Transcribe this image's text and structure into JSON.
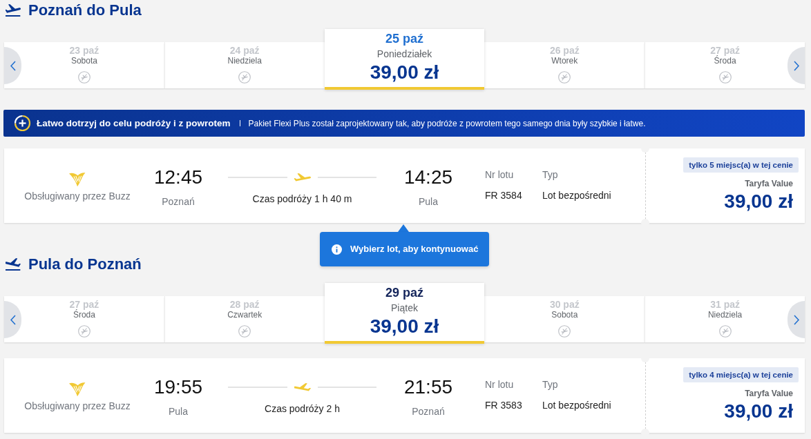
{
  "journeys": [
    {
      "kind": "outbound",
      "title": "Poznań do Pula",
      "days": [
        {
          "date": "23 paź",
          "weekday": "Sobota",
          "available": false,
          "selected": false,
          "hovered": false
        },
        {
          "date": "24 paź",
          "weekday": "Niedziela",
          "available": false,
          "selected": false,
          "hovered": false
        },
        {
          "date": "25 paź",
          "weekday": "Poniedziałek",
          "price": "39,00 zł",
          "available": true,
          "selected": true,
          "hovered": true
        },
        {
          "date": "26 paź",
          "weekday": "Wtorek",
          "available": false,
          "selected": false,
          "hovered": false
        },
        {
          "date": "27 paź",
          "weekday": "Środa",
          "available": false,
          "selected": false,
          "hovered": false
        }
      ],
      "promo_banner": {
        "title": "Łatwo dotrzyj do celu podróży i z powrotem",
        "text": "Pakiet Flexi Plus został zaprojektowany tak, aby podróże z powrotem tego samego dnia były szybkie i łatwe."
      },
      "flight": {
        "operator": "Obsługiwany przez Buzz",
        "departure_time": "12:45",
        "departure_city": "Poznań",
        "duration": "Czas podróży 1 h 40 m",
        "arrival_time": "14:25",
        "arrival_city": "Pula",
        "flight_number_label": "Nr lotu",
        "flight_number": "FR 3584",
        "type_label": "Typ",
        "type": "Lot bezpośredni",
        "seats_badge": "tylko 5 miejsc(a) w tej cenie",
        "fare": "Taryfa Value",
        "price": "39,00 zł"
      },
      "notice": {
        "text": "Wybierz lot, aby kontynuować"
      }
    },
    {
      "kind": "return",
      "title": "Pula do Poznań",
      "days": [
        {
          "date": "27 paź",
          "weekday": "Środa",
          "available": false,
          "selected": false,
          "hovered": false
        },
        {
          "date": "28 paź",
          "weekday": "Czwartek",
          "available": false,
          "selected": false,
          "hovered": false
        },
        {
          "date": "29 paź",
          "weekday": "Piątek",
          "price": "39,00 zł",
          "available": true,
          "selected": true,
          "hovered": false
        },
        {
          "date": "30 paź",
          "weekday": "Sobota",
          "available": false,
          "selected": false,
          "hovered": false
        },
        {
          "date": "31 paź",
          "weekday": "Niedziela",
          "available": false,
          "selected": false,
          "hovered": false
        }
      ],
      "flight": {
        "operator": "Obsługiwany przez Buzz",
        "departure_time": "19:55",
        "departure_city": "Pula",
        "duration": "Czas podróży 2 h",
        "arrival_time": "21:55",
        "arrival_city": "Poznań",
        "flight_number_label": "Nr lotu",
        "flight_number": "FR 3583",
        "type_label": "Typ",
        "type": "Lot bezpośredni",
        "seats_badge": "tylko 4 miejsc(a) w tej cenie",
        "fare": "Taryfa Value",
        "price": "39,00 zł"
      }
    }
  ]
}
